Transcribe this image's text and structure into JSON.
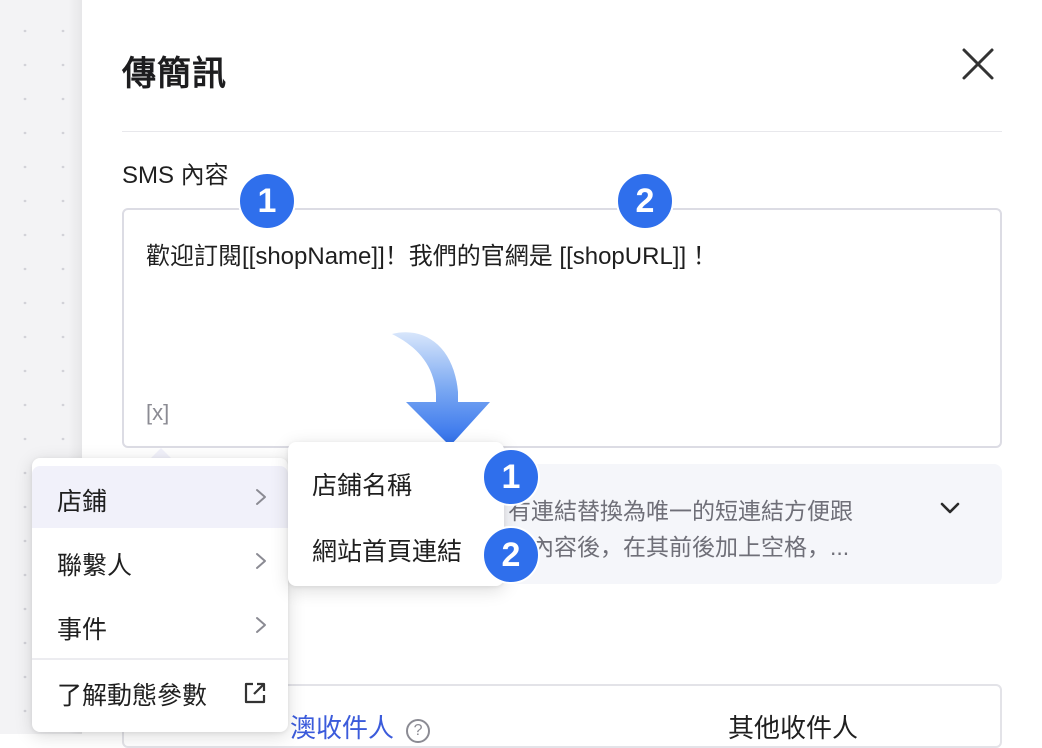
{
  "dialog": {
    "title": "傳簡訊",
    "close_icon": "close-icon"
  },
  "sms": {
    "label": "SMS 內容",
    "content": "歡迎訂閱[[shopName]]！我們的官網是 [[shopURL]] ！",
    "variable_button": "[x]"
  },
  "annotations": {
    "badge1": "1",
    "badge2": "2",
    "badge_color": "#2f6fec"
  },
  "info": {
    "line1": "有連結替換為唯一的短連結方便跟",
    "line2": "見內容後，在其前後加上空格，..."
  },
  "variable_menu": {
    "items": [
      {
        "label": "店鋪",
        "icon": "chevron-right-icon",
        "active": true
      },
      {
        "label": "聯繫人",
        "icon": "chevron-right-icon"
      },
      {
        "label": "事件",
        "icon": "chevron-right-icon"
      }
    ],
    "learn_more": {
      "label": "了解動態參數",
      "icon": "external-link-icon"
    }
  },
  "submenu": {
    "items": [
      {
        "label": "店鋪名稱"
      },
      {
        "label": "網站首頁連結"
      }
    ]
  },
  "recipients": {
    "left_label": "澳收件人",
    "right_label": "其他收件人"
  },
  "colors": {
    "accent": "#3b5bdb",
    "menu_active_bg": "#f1f1fa"
  }
}
